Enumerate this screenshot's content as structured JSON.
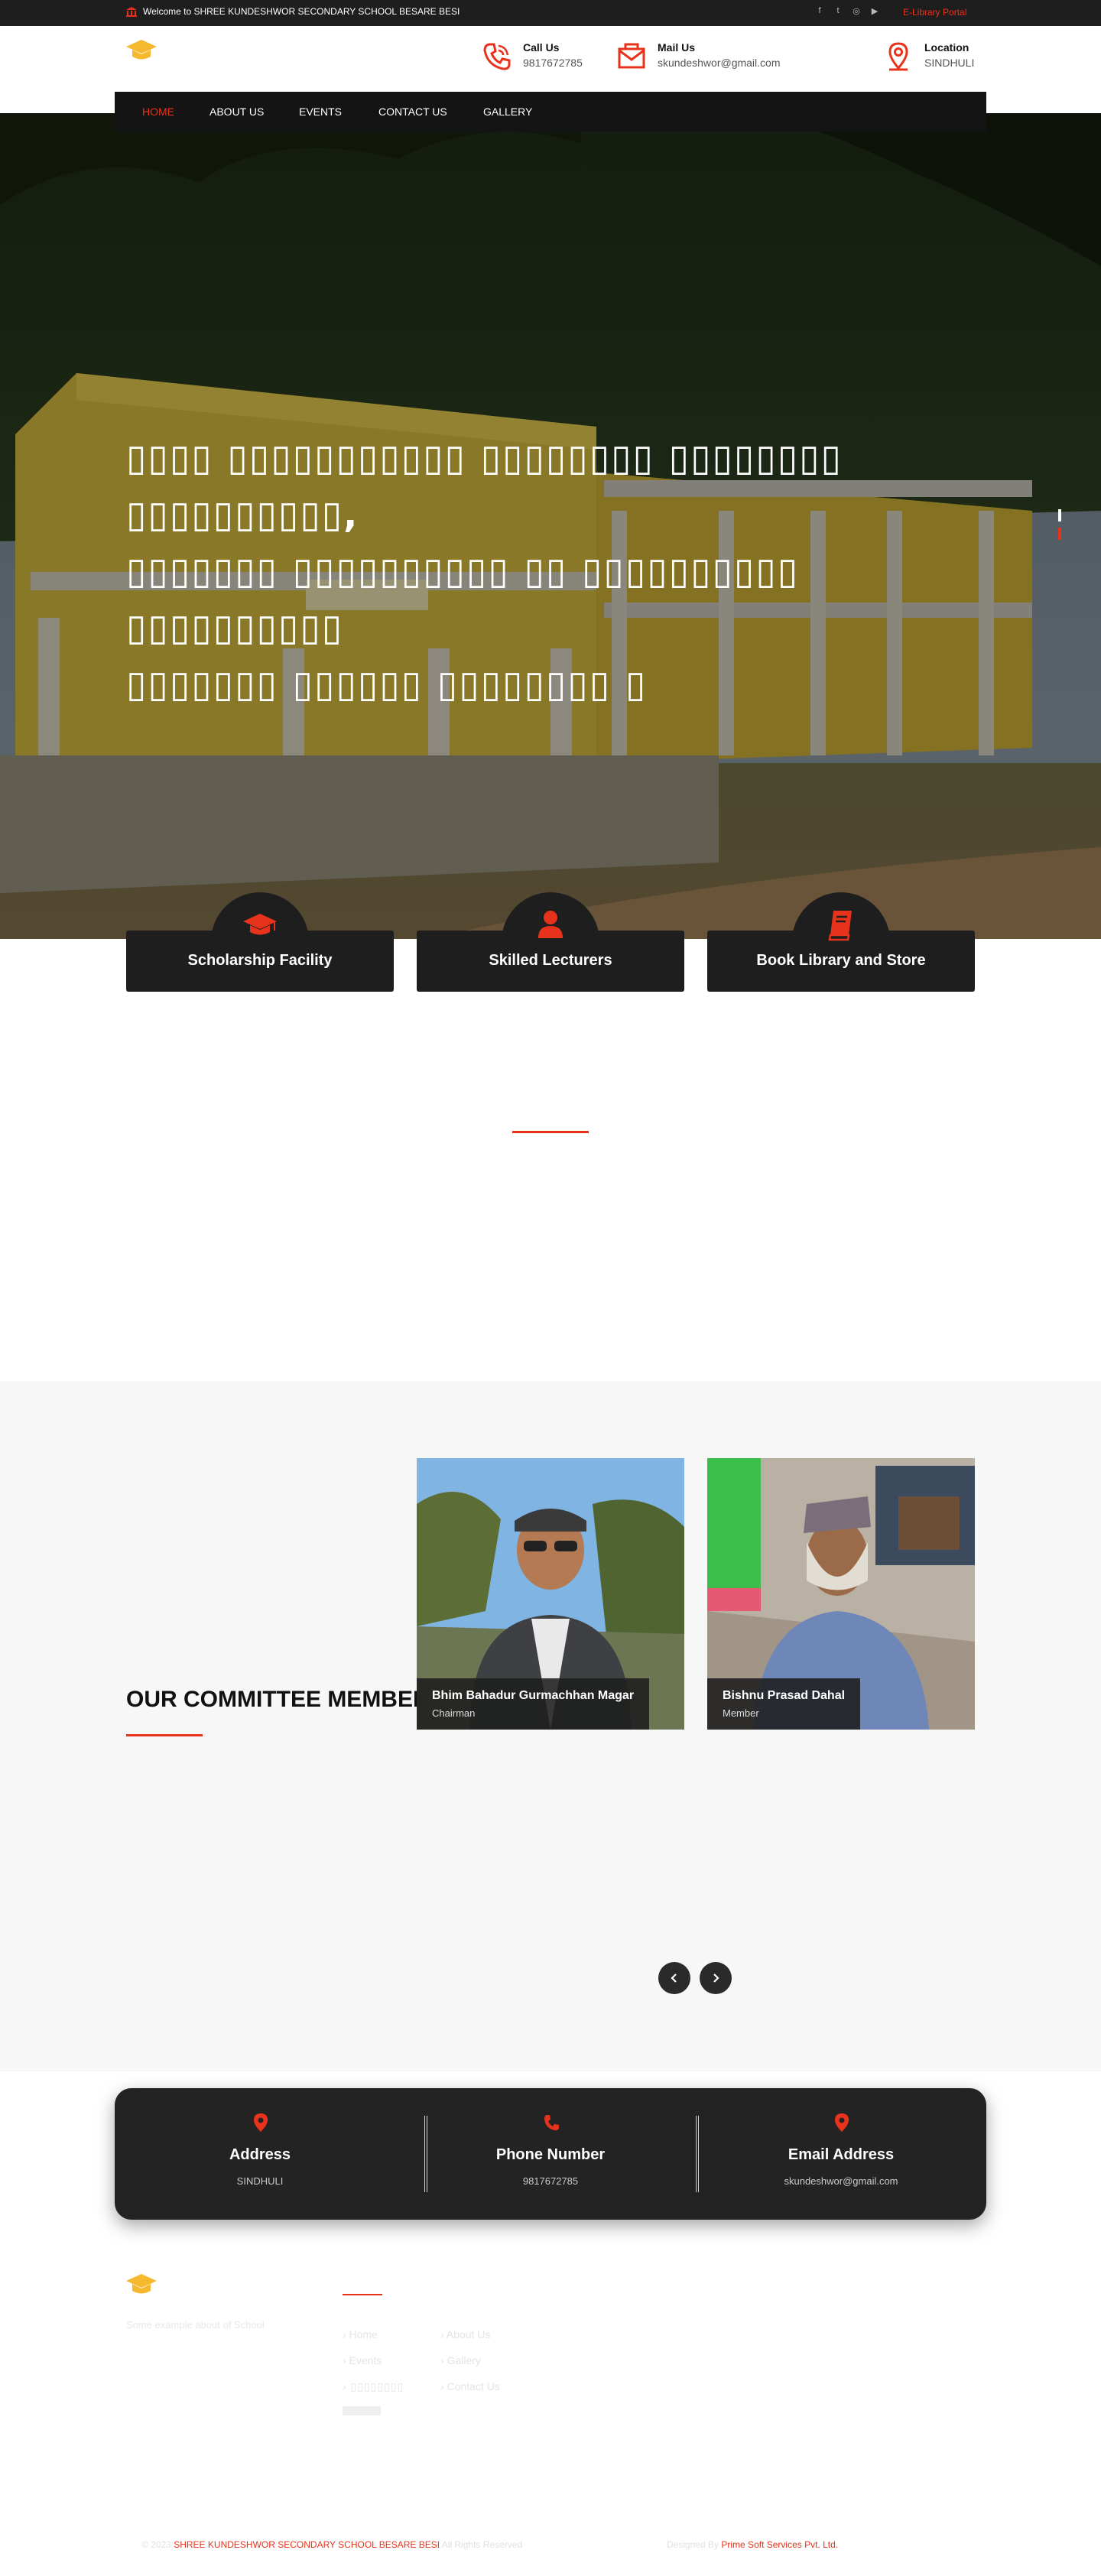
{
  "topbar": {
    "welcome": "Welcome to SHREE KUNDESHWOR SECONDARY SCHOOL BESARE BESI",
    "social_icons": [
      "facebook-icon",
      "twitter-icon",
      "instagram-icon",
      "youtube-icon"
    ],
    "elibrary_label": "E-Library Portal"
  },
  "header": {
    "call": {
      "title": "Call Us",
      "value": "9817672785"
    },
    "mail": {
      "title": "Mail Us",
      "value": "skundeshwor@gmail.com"
    },
    "location": {
      "title": "Location",
      "value": "SINDHULI"
    }
  },
  "nav": {
    "items": [
      {
        "label": "HOME",
        "active": true
      },
      {
        "label": "ABOUT US"
      },
      {
        "label": "EVENTS"
      },
      {
        "label": "CONTACT US"
      },
      {
        "label": "GALLERY"
      }
    ]
  },
  "hero": {
    "slide_count": 2,
    "active_slide": 2
  },
  "features": [
    {
      "title": "Scholarship Facility",
      "icon": "graduation-cap-icon"
    },
    {
      "title": "Skilled Lecturers",
      "icon": "user-icon"
    },
    {
      "title": "Book Library and Store",
      "icon": "book-icon"
    }
  ],
  "committee": {
    "title": "OUR COMMITTEE MEMBERS",
    "members": [
      {
        "name": "Bhim Bahadur Gurmachhan Magar",
        "role": "Chairman"
      },
      {
        "name": "Bishnu Prasad Dahal",
        "role": "Member"
      }
    ],
    "prev_icon": "chevron-left-icon",
    "next_icon": "chevron-right-icon"
  },
  "contact_strip": {
    "address": {
      "title": "Address",
      "value": "SINDHULI"
    },
    "phone": {
      "title": "Phone Number",
      "value": "9817672785"
    },
    "email": {
      "title": "Email Address",
      "value": "skundeshwor@gmail.com"
    }
  },
  "footer": {
    "about_text": "Some example about of School",
    "links_col1": [
      "Home",
      "Events"
    ],
    "links_col2": [
      "About Us",
      "Gallery",
      "Contact Us"
    ],
    "copyright_prefix": "© 2023",
    "school_name": "SHREE KUNDESHWOR SECONDARY SCHOOL BESARE BESI",
    "rights": "All Rights Reserved",
    "designed_by_label": "Designed By",
    "designer": "Prime Soft Services Pvt. Ltd."
  },
  "colors": {
    "accent": "#e8331c",
    "logo_yellow": "#f5b82e",
    "dark": "#1e1e1e"
  }
}
